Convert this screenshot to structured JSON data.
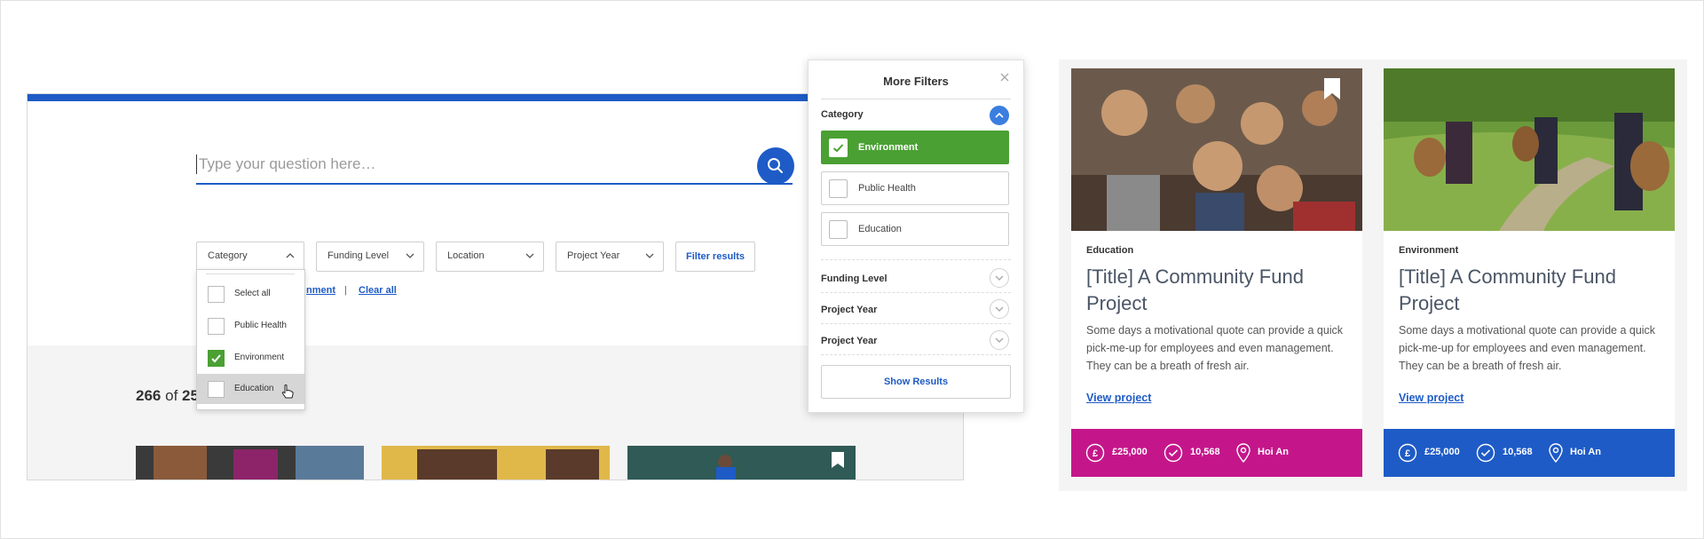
{
  "search": {
    "placeholder": "Type your question here…",
    "filters": [
      "Category",
      "Funding Level",
      "Location",
      "Project Year"
    ],
    "filter_button": "Filter results",
    "active_tag": "nment",
    "clear_all": "Clear all",
    "results_count": "266",
    "results_of": "of",
    "results_total": "25"
  },
  "category_dropdown": {
    "items": [
      {
        "label": "Select all",
        "checked": false
      },
      {
        "label": "Public Health",
        "checked": false
      },
      {
        "label": "Environment",
        "checked": true
      },
      {
        "label": "Education",
        "checked": false
      }
    ]
  },
  "more_filters": {
    "title": "More Filters",
    "sections": [
      "Category",
      "Funding Level",
      "Project Year",
      "Project Year"
    ],
    "options": [
      {
        "label": "Environment",
        "checked": true
      },
      {
        "label": "Public Health",
        "checked": false
      },
      {
        "label": "Education",
        "checked": false
      }
    ],
    "show_results": "Show Results"
  },
  "cards": [
    {
      "category": "Education",
      "title": "[Title] A Community Fund Project",
      "description": "Some days a motivational quote can provide a quick pick-me-up for employees and even management. They can be a breath of fresh air.",
      "link": "View project",
      "amount": "£25,000",
      "count": "10,568",
      "location": "Hoi An",
      "footer_color": "#c4168a"
    },
    {
      "category": "Environment",
      "title": "[Title] A Community Fund Project",
      "description": "Some days a motivational quote can provide a quick pick-me-up for employees and even management. They can be a breath of fresh air.",
      "link": "View project",
      "amount": "£25,000",
      "count": "10,568",
      "location": "Hoi An",
      "footer_color": "#1e5bc6"
    }
  ],
  "colors": {
    "accent": "#1e5bc6",
    "green": "#4aa033",
    "magenta": "#c4168a"
  }
}
